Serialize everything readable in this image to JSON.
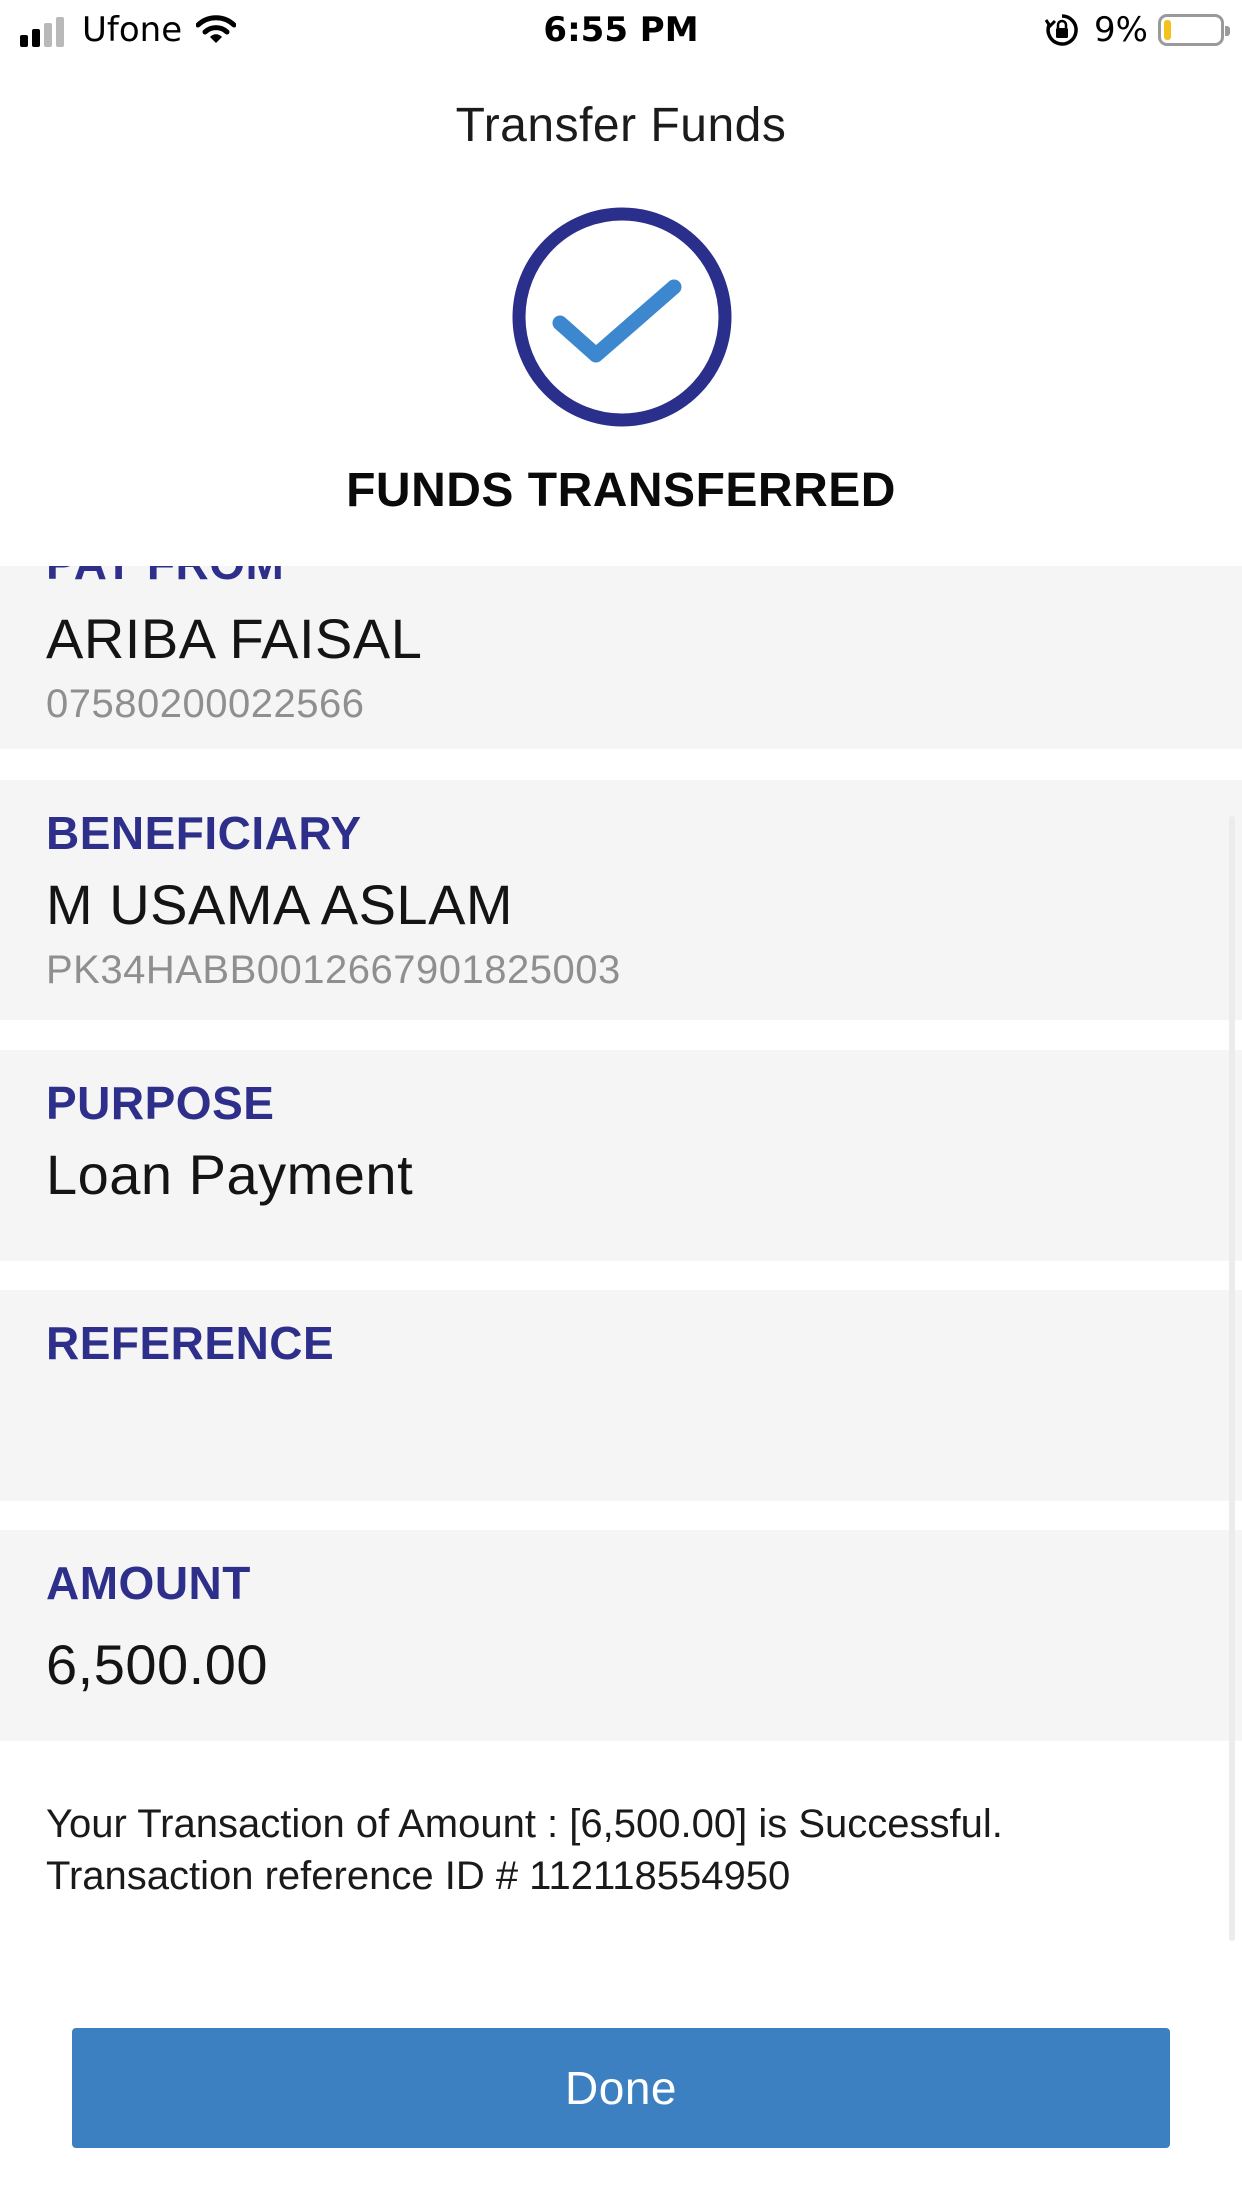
{
  "status_bar": {
    "carrier": "Ufone",
    "time": "6:55 PM",
    "battery_percent": "9%",
    "battery_level": 0.09,
    "battery_color": "#f3c21b",
    "icons": [
      "cellular-signal-icon",
      "wifi-icon",
      "orientation-lock-icon",
      "battery-icon"
    ]
  },
  "header": {
    "title": "Transfer Funds"
  },
  "success": {
    "icon": "checkmark-circle-icon",
    "title": "FUNDS TRANSFERRED",
    "ring_color": "#2a2f8c",
    "check_color": "#3d87cf"
  },
  "details": {
    "pay_from": {
      "label": "PAY FROM",
      "name": "ARIBA FAISAL",
      "account": "07580200022566"
    },
    "beneficiary": {
      "label": "BENEFICIARY",
      "name": "M USAMA ASLAM",
      "account": "PK34HABB0012667901825003"
    },
    "purpose": {
      "label": "PURPOSE",
      "value": "Loan Payment"
    },
    "reference": {
      "label": "REFERENCE",
      "value": ""
    },
    "amount": {
      "label": "AMOUNT",
      "value": "6,500.00"
    }
  },
  "message": {
    "line1": "Your Transaction of Amount : [6,500.00] is Successful.",
    "line2": "Transaction reference ID # 112118554950"
  },
  "actions": {
    "done_label": "Done"
  },
  "colors": {
    "label_color": "#2e2f8a",
    "card_background": "#f5f5f5",
    "button_color": "#3d80c2"
  }
}
